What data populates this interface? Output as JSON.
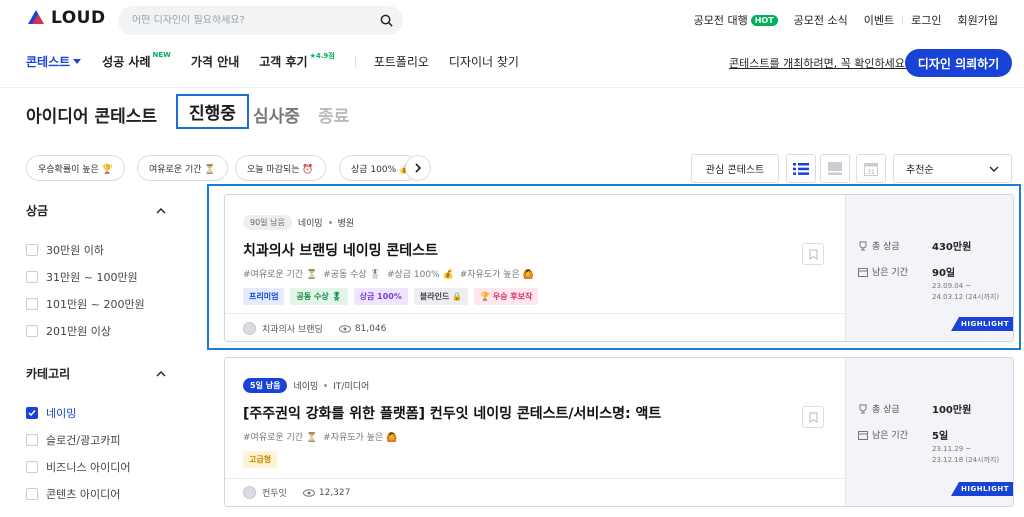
{
  "header": {
    "logo": "LOUD",
    "search_placeholder": "어떤 디자인이 필요하세요?",
    "links": [
      {
        "label": "공모전 대행",
        "badge": "HOT"
      },
      {
        "label": "공모전 소식"
      },
      {
        "label": "이벤트"
      },
      {
        "label": "로그인"
      },
      {
        "label": "회원가입"
      }
    ]
  },
  "nav": {
    "items": [
      {
        "label": "콘테스트"
      },
      {
        "label": "성공 사례",
        "badge": "NEW"
      },
      {
        "label": "가격 안내"
      },
      {
        "label": "고객 후기",
        "badge": "★4.9점"
      },
      {
        "label": "포트폴리오"
      },
      {
        "label": "디자이너 찾기"
      }
    ],
    "notice": "콘테스트를 개최하려면, 꼭 확인하세요!",
    "cta": "디자인 의뢰하기"
  },
  "page": {
    "title": "아이디어 콘테스트",
    "tabs": [
      "진행중",
      "심사중",
      "종료"
    ],
    "active_tab": "진행중"
  },
  "filters": {
    "chips": [
      "우승확률이 높은 🏆",
      "여유로운 기간 ⏳",
      "오늘 마감되는 ⏰",
      "상금 100% 💰"
    ],
    "favorite": "관심 콘테스트",
    "sort": "추천순"
  },
  "sidebar": {
    "prize": {
      "title": "상금",
      "options": [
        "30만원 이하",
        "31만원 ~ 100만원",
        "101만원 ~ 200만원",
        "201만원 이상"
      ]
    },
    "category": {
      "title": "카테고리",
      "options": [
        {
          "label": "네이밍",
          "checked": true
        },
        {
          "label": "슬로건/광고카피",
          "checked": false
        },
        {
          "label": "비즈니스 아이디어",
          "checked": false
        },
        {
          "label": "콘텐츠 아이디어",
          "checked": false
        }
      ]
    }
  },
  "cards": [
    {
      "dday": "90일 남음",
      "category": "네이밍",
      "industry": "병원",
      "title": "치과의사 브랜딩 네이밍 콘테스트",
      "tags": [
        "#여유로운 기간 ⏳",
        "#공동 수상 🎖",
        "#상금 100% 💰",
        "#자유도가 높은 🙆"
      ],
      "pills": [
        {
          "label": "프리미엄",
          "bg": "#e4ecff",
          "fg": "#1843d6"
        },
        {
          "label": "공동 수상 🎖",
          "bg": "#e2f5e9",
          "fg": "#128a46"
        },
        {
          "label": "상금 100%",
          "bg": "#efe5ff",
          "fg": "#7a3fd6"
        },
        {
          "label": "블라인드 🔒",
          "bg": "#eceef1",
          "fg": "#444"
        },
        {
          "label": "🏆 우승 후보작",
          "bg": "#ffe7ef",
          "fg": "#d6336c"
        }
      ],
      "owner": "치과의사 브랜딩",
      "views": "81,046",
      "prize_label": "총 상금",
      "prize": "430만원",
      "period_label": "남은 기간",
      "period": "90일",
      "dates": [
        "23.09.04 ~",
        "24.03.12 (24시까지)"
      ],
      "highlight": "HIGHLIGHT"
    },
    {
      "dday": "5일 남음",
      "category": "네이밍",
      "industry": "IT/미디어",
      "title": "[주주권익 강화를 위한 플랫폼] 컨두잇 네이밍 콘테스트/서비스명: 액트",
      "tags": [
        "#여유로운 기간 ⏳",
        "#자유도가 높은 🙆"
      ],
      "pills": [
        {
          "label": "고급형",
          "bg": "#fff3d6",
          "fg": "#c98a00"
        }
      ],
      "owner": "컨두잇",
      "views": "12,327",
      "prize_label": "총 상금",
      "prize": "100만원",
      "period_label": "남은 기간",
      "period": "5일",
      "dates": [
        "23.11.29 ~",
        "23.12.18 (24시까지)"
      ],
      "highlight": "HIGHLIGHT"
    }
  ]
}
